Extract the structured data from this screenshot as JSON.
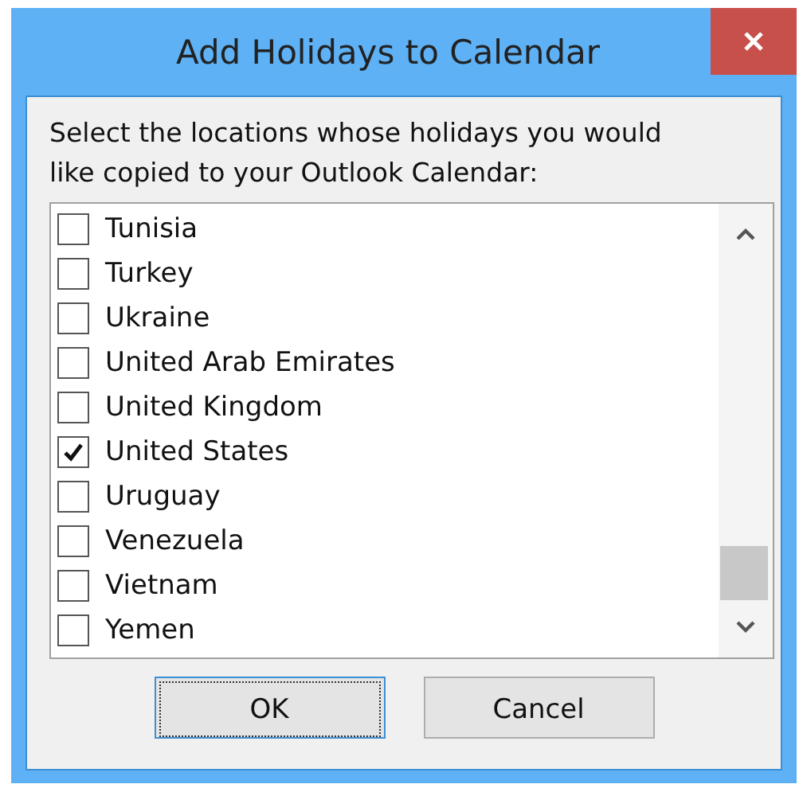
{
  "window": {
    "title": "Add Holidays to Calendar"
  },
  "instruction": "Select the locations whose holidays you would like copied to your Outlook Calendar:",
  "locations": [
    {
      "label": "Tunisia",
      "checked": false
    },
    {
      "label": "Turkey",
      "checked": false
    },
    {
      "label": "Ukraine",
      "checked": false
    },
    {
      "label": "United Arab Emirates",
      "checked": false
    },
    {
      "label": "United Kingdom",
      "checked": false
    },
    {
      "label": "United States",
      "checked": true
    },
    {
      "label": "Uruguay",
      "checked": false
    },
    {
      "label": "Venezuela",
      "checked": false
    },
    {
      "label": "Vietnam",
      "checked": false
    },
    {
      "label": "Yemen",
      "checked": false
    }
  ],
  "buttons": [
    {
      "label": "OK",
      "focused": true
    },
    {
      "label": "Cancel",
      "focused": false
    }
  ]
}
